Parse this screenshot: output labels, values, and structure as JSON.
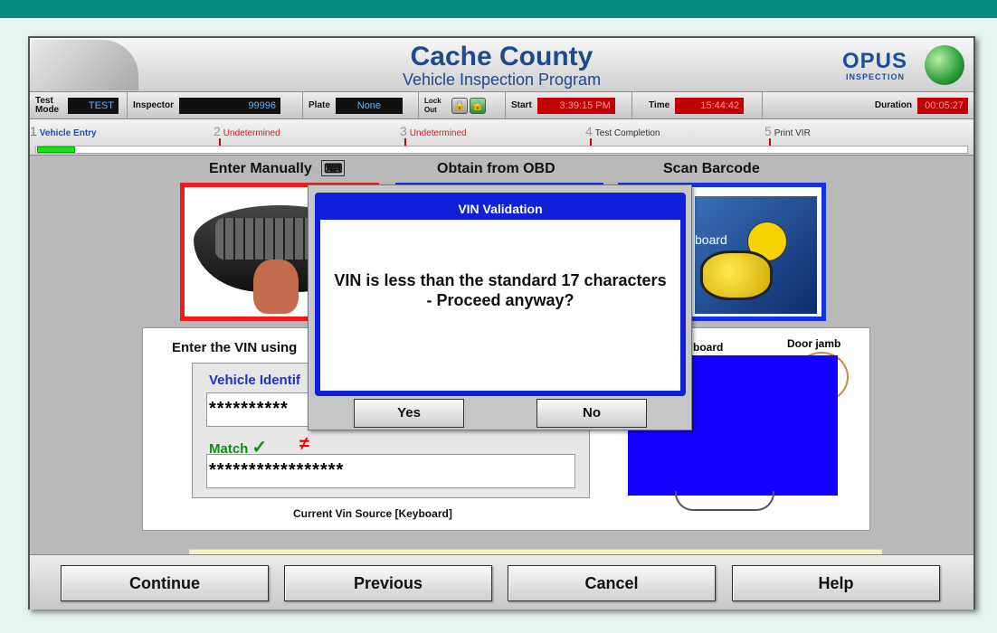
{
  "header": {
    "title": "Cache County",
    "subtitle": "Vehicle Inspection Program",
    "logo_text": "OPUS",
    "logo_sub": "INSPECTION"
  },
  "status": {
    "test_mode_label": "Test Mode",
    "test_mode_value": "TEST",
    "inspector_label": "Inspector",
    "inspector_value": "99996",
    "plate_label": "Plate",
    "plate_value": "None",
    "lockout_label": "Lock Out",
    "start_label": "Start",
    "start_value": "3:39:15 PM",
    "time_label": "Time",
    "time_value": "15:44:42",
    "duration_label": "Duration",
    "duration_value": "00:05:27"
  },
  "steps": [
    {
      "num": "1",
      "label": "Vehicle Entry"
    },
    {
      "num": "2",
      "label": "Undetermined"
    },
    {
      "num": "3",
      "label": "Undetermined"
    },
    {
      "num": "4",
      "label": "Test Completion"
    },
    {
      "num": "5",
      "label": "Print VIR"
    }
  ],
  "sources": {
    "manual": "Enter Manually",
    "obd": "Obtain from OBD",
    "barcode": "Scan Barcode"
  },
  "vin_entry": {
    "prompt": "Enter the VIN using",
    "field_label": "Vehicle Identif",
    "vin_value": "**********",
    "match_label": "Match",
    "match_check": "✓",
    "match_neq": "≠",
    "match_value": "*****************",
    "source_text": "Current Vin Source [Keyboard]",
    "loc_dash": "board",
    "loc_door": "Door jamb",
    "barcode_partial": "board"
  },
  "dialog": {
    "title": "VIN Validation",
    "message": "VIN is less than the standard 17 characters - Proceed anyway?",
    "yes_label": "Yes",
    "no_label": "No"
  },
  "buttons": {
    "continue": "Continue",
    "previous": "Previous",
    "cancel": "Cancel",
    "help": "Help"
  }
}
